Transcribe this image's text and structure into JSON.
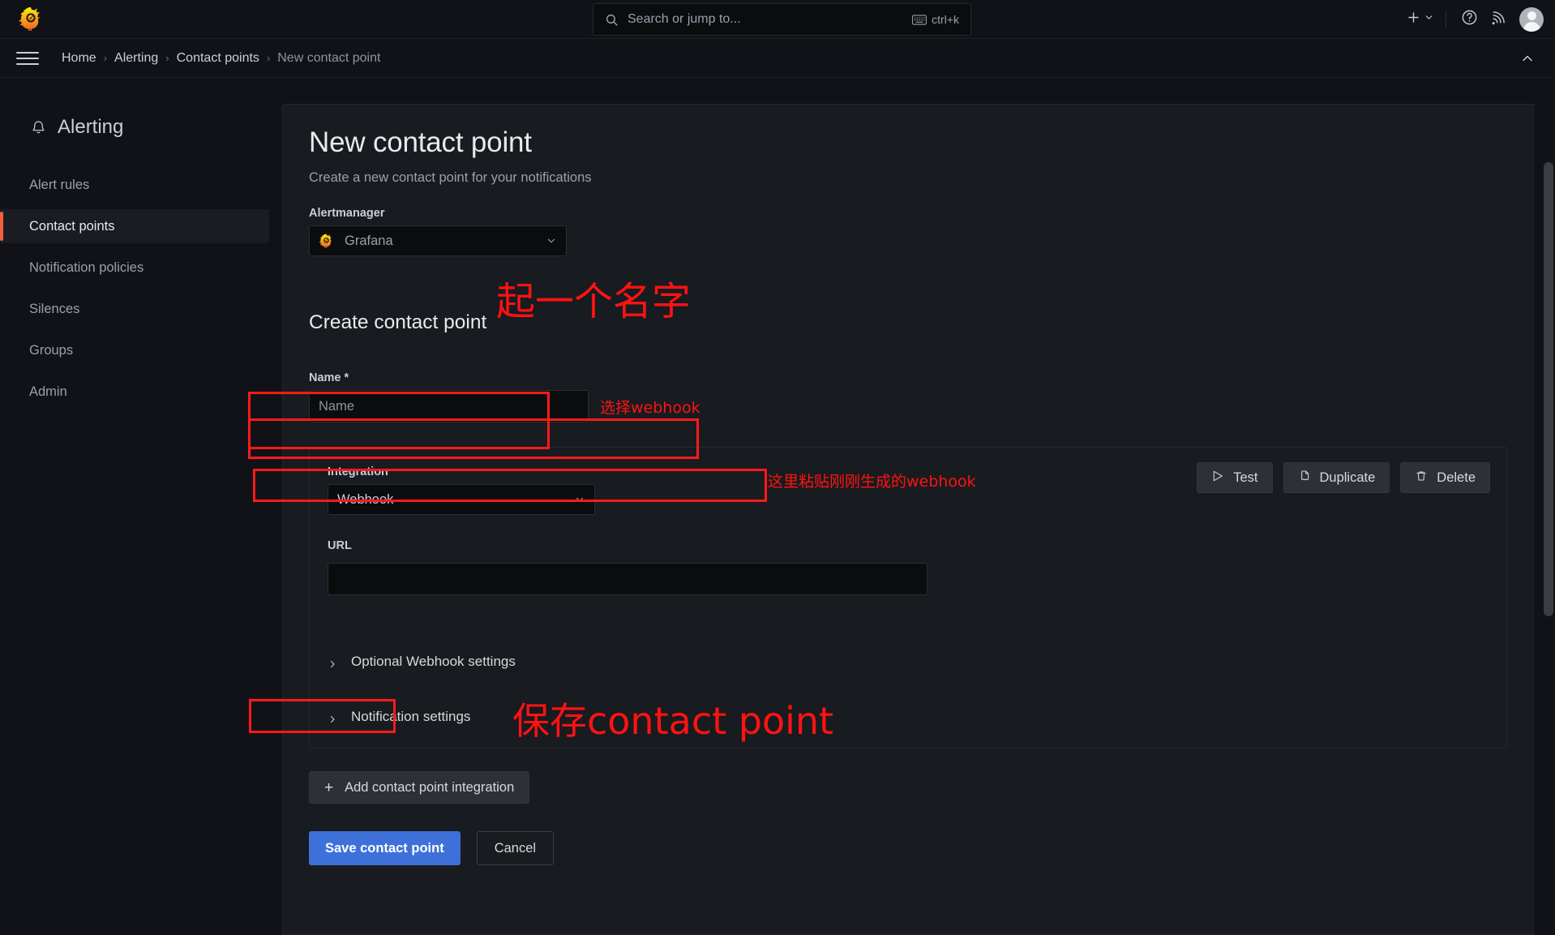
{
  "topbar": {
    "logo_icon": "grafana-logo-icon",
    "search": {
      "placeholder": "Search or jump to...",
      "icon": "search-icon",
      "shortcut": "ctrl+k",
      "shortcut_icon": "keyboard-icon"
    },
    "actions": {
      "new_icon": "plus-icon",
      "new_caret_icon": "chevron-down-icon",
      "help_icon": "question-circle-icon",
      "news_icon": "rss-icon",
      "avatar": "user-avatar"
    }
  },
  "breadcrumb": {
    "menu_icon": "hamburger-menu-icon",
    "items": [
      {
        "label": "Home"
      },
      {
        "label": "Alerting"
      },
      {
        "label": "Contact points"
      },
      {
        "label": "New contact point"
      }
    ],
    "separator": "›",
    "collapse_icon": "chevron-up-icon"
  },
  "sidebar": {
    "title": "Alerting",
    "title_icon": "bell-icon",
    "items": [
      {
        "label": "Alert rules",
        "active": false
      },
      {
        "label": "Contact points",
        "active": true
      },
      {
        "label": "Notification policies",
        "active": false
      },
      {
        "label": "Silences",
        "active": false
      },
      {
        "label": "Groups",
        "active": false
      },
      {
        "label": "Admin",
        "active": false
      }
    ]
  },
  "main": {
    "title": "New contact point",
    "subtitle": "Create a new contact point for your notifications",
    "alertmanager": {
      "label": "Alertmanager",
      "value": "Grafana",
      "logo_icon": "grafana-logo-icon",
      "caret_icon": "chevron-down-icon"
    },
    "section_title": "Create contact point",
    "name_field": {
      "label": "Name *",
      "placeholder": "Name",
      "value": ""
    },
    "integration": {
      "label": "Integration",
      "value": "Webhook",
      "caret_icon": "chevron-down-icon"
    },
    "url_field": {
      "label": "URL",
      "value": "",
      "placeholder": ""
    },
    "card_actions": [
      {
        "label": "Test",
        "icon": "send-play-icon"
      },
      {
        "label": "Duplicate",
        "icon": "copy-icon"
      },
      {
        "label": "Delete",
        "icon": "trash-icon"
      }
    ],
    "collapsibles": [
      {
        "label": "Optional Webhook settings",
        "icon": "chevron-right-icon",
        "expanded": false
      },
      {
        "label": "Notification settings",
        "icon": "chevron-right-icon",
        "expanded": false
      }
    ],
    "add_integration_button": {
      "label": "Add contact point integration",
      "icon": "plus-icon"
    },
    "save_button": "Save contact point",
    "cancel_button": "Cancel"
  },
  "annotations": {
    "color": "#ff1212",
    "name_hint": "起一个名字",
    "integration_hint": "选择webhook",
    "url_hint": "这里粘贴刚刚生成的webhook",
    "save_hint": "保存contact point"
  },
  "theme": {
    "accent": "#f55f3e",
    "primary_button": "#3d71d9",
    "annotation_red": "#ff1212",
    "page_bg": "#111217",
    "panel_bg": "#181b1f"
  }
}
